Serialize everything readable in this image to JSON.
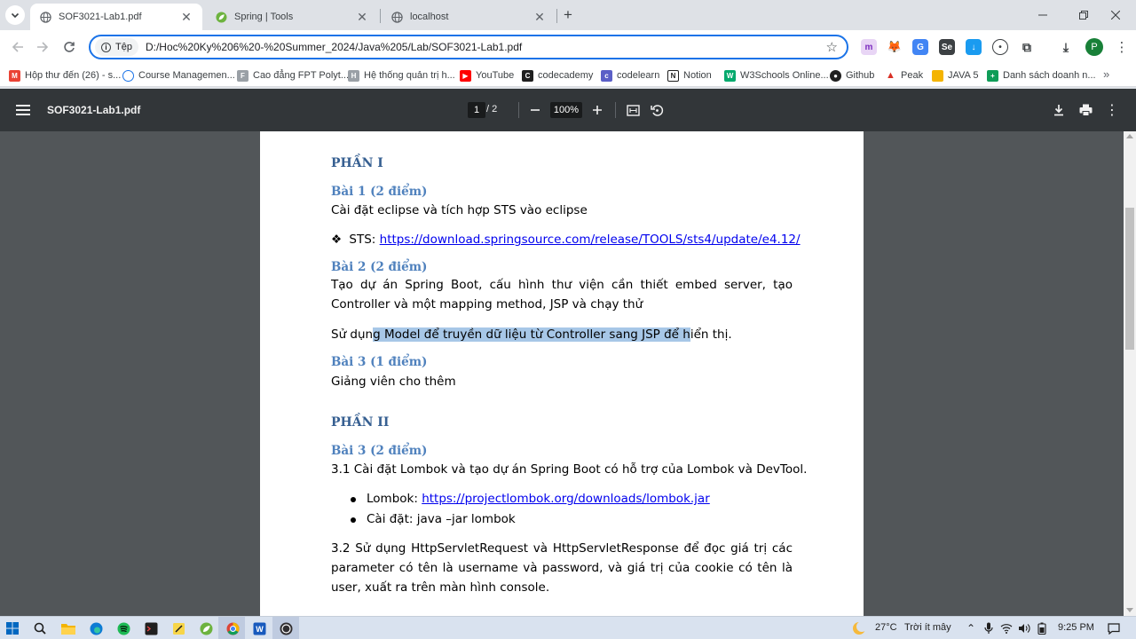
{
  "tabs": [
    {
      "title": "SOF3021-Lab1.pdf",
      "active": true,
      "icon": "globe-icon"
    },
    {
      "title": "Spring | Tools",
      "active": false,
      "icon": "spring-leaf-icon"
    },
    {
      "title": "localhost",
      "active": false,
      "icon": "globe-icon"
    }
  ],
  "toolbar": {
    "site_chip": "Tệp",
    "url": "D:/Hoc%20Ky%206%20-%20Summer_2024/Java%205/Lab/SOF3021-Lab1.pdf",
    "profile_initial": "P"
  },
  "bookmarks": [
    {
      "label": "Hộp thư đến (26) - s...",
      "icon": "gmail-icon",
      "color": "#ea4335"
    },
    {
      "label": "Course Managemen...",
      "icon": "course-icon",
      "color": "#1a73e8"
    },
    {
      "label": "Cao đẳng FPT Polyt...",
      "icon": "fpt-icon",
      "color": "#9aa0a6"
    },
    {
      "label": "Hệ thống quản trị h...",
      "icon": "lms-icon",
      "color": "#9aa0a6"
    },
    {
      "label": "YouTube",
      "icon": "youtube-icon",
      "color": "#ff0000"
    },
    {
      "label": "codecademy",
      "icon": "codecademy-icon",
      "color": "#1f1f1f"
    },
    {
      "label": "codelearn",
      "icon": "codelearn-icon",
      "color": "#5b5fc7"
    },
    {
      "label": "Notion",
      "icon": "notion-icon",
      "color": "#1f1f1f"
    },
    {
      "label": "W3Schools Online...",
      "icon": "w3schools-icon",
      "color": "#04aa6d"
    },
    {
      "label": "Github",
      "icon": "github-icon",
      "color": "#1f1f1f"
    },
    {
      "label": "Peak",
      "icon": "peak-icon",
      "color": "#d93025"
    },
    {
      "label": "JAVA 5",
      "icon": "folder-icon",
      "color": "#f4b400"
    },
    {
      "label": "Danh sách doanh n...",
      "icon": "sheet-icon",
      "color": "#0f9d58"
    }
  ],
  "pdf": {
    "title": "SOF3021-Lab1.pdf",
    "current_page": "1",
    "total_pages": "/  2",
    "zoom": "100%"
  },
  "doc": {
    "part1": "PHẦN I",
    "bai1_title": "Bài 1 (2 điểm)",
    "bai1_text": "Cài đặt eclipse và tích hợp STS vào eclipse",
    "sts_bullet": "❖",
    "sts_label": "STS: ",
    "sts_link": "https://download.springsource.com/release/TOOLS/sts4/update/e4.12/",
    "bai2_title": "Bài 2 (2 điểm)",
    "bai2_text": "Tạo dự án Spring Boot, cấu hình thư viện cần thiết embed server, tạo Controller và một mapping method, JSP và chạy thử",
    "model_pre": "Sử dụn",
    "model_hl": "g Model để truyền dữ liệu từ Controller sang JSP để h",
    "model_post": "iển thị.",
    "bai3a_title": "Bài 3 (1 điểm)",
    "bai3a_text": "Giảng viên cho thêm",
    "part2": "PHẦN II",
    "bai3b_title": "Bài 3 (2 điểm)",
    "bai3b_text": "3.1 Cài đặt Lombok và tạo dự án Spring Boot có hỗ trợ của Lombok và DevTool.",
    "lombok_label": "Lombok: ",
    "lombok_link": "https://projectlombok.org/downloads/lombok.jar",
    "install_text": "Cài đặt: java –jar lombok",
    "p32_text": "3.2 Sử dụng HttpServletRequest và HttpServletResponse để đọc giá trị các parameter có tên là username và password, và giá trị của cookie có tên là user, xuất ra trên màn hình console."
  },
  "taskbar": {
    "temperature": "27°C",
    "weather": "Trời ít mây",
    "time": "9:25 PM"
  }
}
